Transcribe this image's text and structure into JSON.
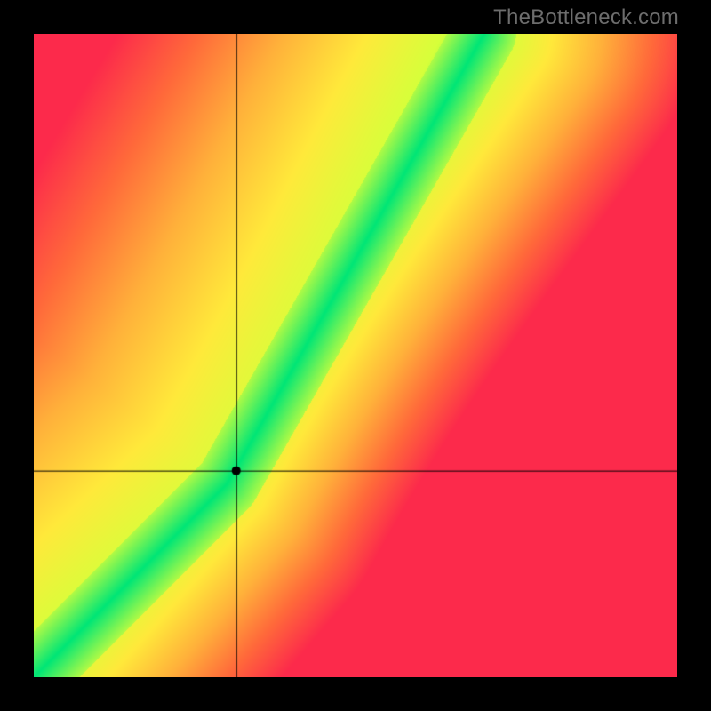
{
  "branding": {
    "watermark": "TheBottleneck.com"
  },
  "layout": {
    "frame_size": 800,
    "plot_inset": 38,
    "plot_size": 724
  },
  "chart_data": {
    "type": "heatmap",
    "title": "",
    "xlabel": "",
    "ylabel": "",
    "xlim": [
      0,
      1
    ],
    "ylim": [
      0,
      1
    ],
    "crosshair": {
      "x": 0.315,
      "y": 0.32
    },
    "marker": {
      "x": 0.315,
      "y": 0.32,
      "radius_px": 5,
      "color": "#000000"
    },
    "ridge": {
      "description": "Piecewise-linear green optimum ridge (plot-fraction coords, origin bottom-left)",
      "points": [
        {
          "x": 0.0,
          "y": 0.0
        },
        {
          "x": 0.3,
          "y": 0.3
        },
        {
          "x": 0.7,
          "y": 1.0
        }
      ],
      "half_width_frac": 0.05
    },
    "gradient_stops": [
      {
        "t": 0.0,
        "color": "#00e676"
      },
      {
        "t": 0.22,
        "color": "#d7ff3a"
      },
      {
        "t": 0.4,
        "color": "#ffe93a"
      },
      {
        "t": 0.6,
        "color": "#ffb13a"
      },
      {
        "t": 0.8,
        "color": "#ff6a3a"
      },
      {
        "t": 1.0,
        "color": "#fc2a4b"
      }
    ],
    "corner_bias": {
      "description": "Additional distance weighting toward warm at far corners",
      "top_right_pull": 0.35,
      "bottom_right_pull": 0.55,
      "top_left_pull": 0.55
    }
  }
}
